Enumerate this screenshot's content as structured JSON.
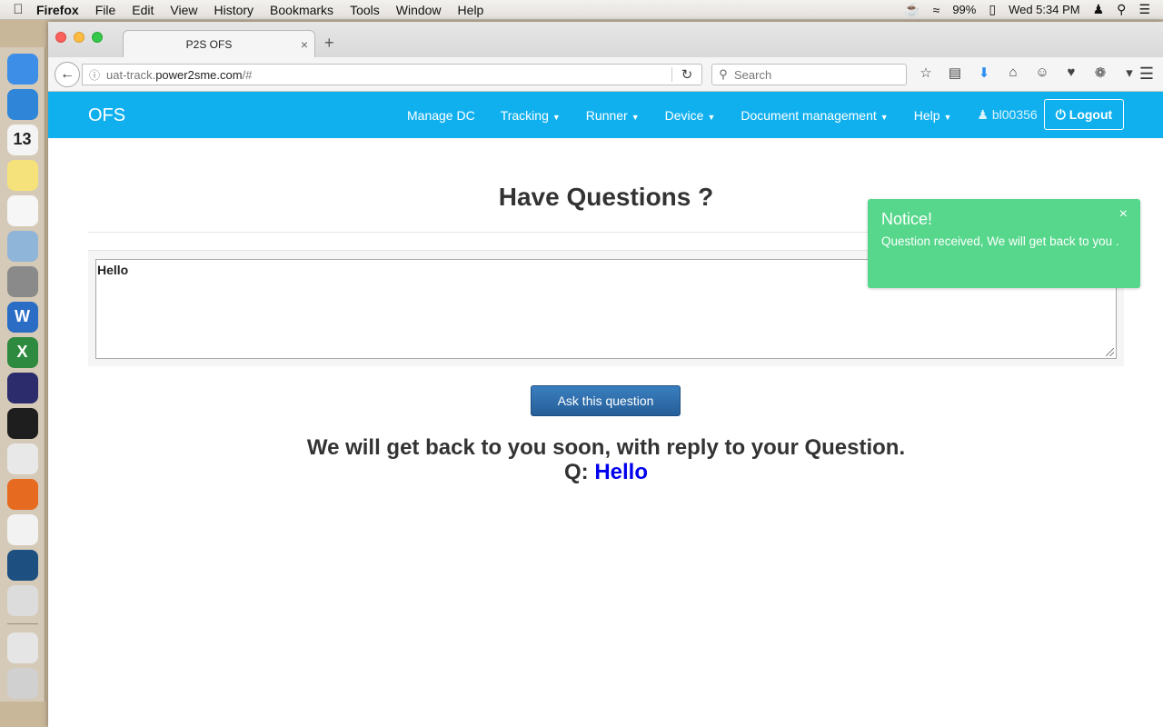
{
  "menubar": {
    "app_name": "Firefox",
    "items": [
      "File",
      "Edit",
      "View",
      "History",
      "Bookmarks",
      "Tools",
      "Window",
      "Help"
    ],
    "battery": "99%",
    "clock": "Wed 5:34 PM"
  },
  "dock": {
    "apps": [
      {
        "icon": "finder-icon",
        "color": "#3d8ee6"
      },
      {
        "icon": "safari-icon",
        "color": "#2f86d9"
      },
      {
        "icon": "calendar-icon",
        "color": "#f4f4f4",
        "label": "13"
      },
      {
        "icon": "notes-icon",
        "color": "#f6e27a"
      },
      {
        "icon": "reminders-icon",
        "color": "#f6f6f6"
      },
      {
        "icon": "preview-icon",
        "color": "#8fb5d8"
      },
      {
        "icon": "system-preferences-icon",
        "color": "#8a8a8a"
      },
      {
        "icon": "word-icon",
        "color": "#2b6cc4",
        "label": "W"
      },
      {
        "icon": "excel-icon",
        "color": "#2e8a3f",
        "label": "X"
      },
      {
        "icon": "eclipse-icon",
        "color": "#2c2c6c"
      },
      {
        "icon": "terminal-icon",
        "color": "#1e1e1e"
      },
      {
        "icon": "chrome-icon",
        "color": "#e8e8e8"
      },
      {
        "icon": "firefox-icon",
        "color": "#e66a1f"
      },
      {
        "icon": "textedit-icon",
        "color": "#f2f2f2"
      },
      {
        "icon": "mysql-workbench-icon",
        "color": "#1d4f80"
      },
      {
        "icon": "jug-icon",
        "color": "#dcdcdc"
      },
      {
        "icon": "downloads-stack-icon",
        "color": "#e5e5e5"
      },
      {
        "icon": "trash-icon",
        "color": "#d0d0d0"
      }
    ]
  },
  "browser": {
    "tab_title": "P2S OFS",
    "url_prefix": "uat-track.",
    "url_host": "power2sme.com",
    "url_suffix": "/#",
    "search_placeholder": "Search"
  },
  "site": {
    "brand": "OFS",
    "nav": [
      {
        "label": "Manage DC",
        "dropdown": false
      },
      {
        "label": "Tracking",
        "dropdown": true
      },
      {
        "label": "Runner",
        "dropdown": true
      },
      {
        "label": "Device",
        "dropdown": true
      },
      {
        "label": "Document management",
        "dropdown": true
      },
      {
        "label": "Help",
        "dropdown": true
      }
    ],
    "user": "bl00356",
    "logout": "Logout"
  },
  "main": {
    "heading": "Have Questions ?",
    "question_value": "Hello",
    "ask_button": "Ask this question",
    "reply_message": "We will get back to you soon, with reply to your Question.",
    "q_label": "Q:",
    "q_value": "Hello"
  },
  "notice": {
    "title": "Notice!",
    "message": "Question received, We will get back to you .",
    "close": "×"
  },
  "colors": {
    "navbar": "#10b0ef",
    "notice": "#56d78b",
    "button": "#2c6ead",
    "link": "#0000ee"
  }
}
